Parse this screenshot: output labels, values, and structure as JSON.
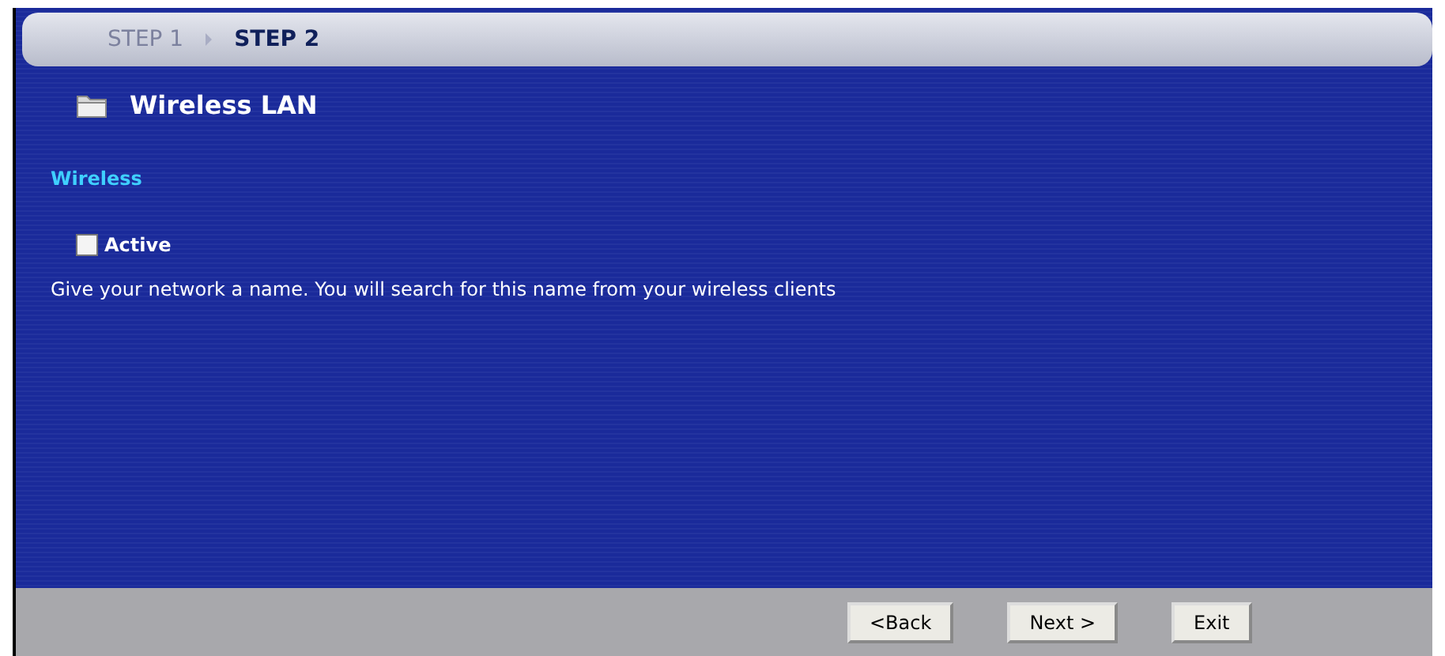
{
  "steps": [
    {
      "label": "STEP 1",
      "selected": false
    },
    {
      "label": "STEP 2",
      "selected": true
    }
  ],
  "title": "Wireless LAN",
  "section": "Wireless",
  "active": {
    "label": "Active",
    "checked": false
  },
  "description": "Give your network a name. You will search for this name from your wireless clients",
  "buttons": [
    {
      "label": "<Back"
    },
    {
      "label": "Next >"
    },
    {
      "label": "Exit"
    }
  ]
}
